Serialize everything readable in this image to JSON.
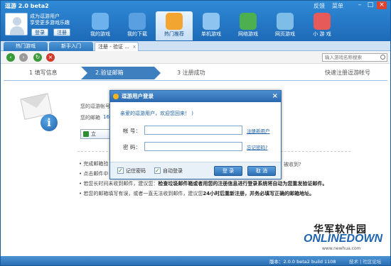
{
  "app": {
    "title": "逗游 2.0 beta2"
  },
  "titlebar": {
    "feedback": "反馈",
    "menu": "菜单"
  },
  "user": {
    "line1": "成为逗游用户",
    "line2": "享受更多游戏乐趣",
    "login_label": "登录",
    "register_label": "注册"
  },
  "nav": {
    "items": [
      {
        "label": "我的游戏",
        "icon": "gamepad-icon",
        "color": "#6db2ec"
      },
      {
        "label": "我的下载",
        "icon": "download-icon",
        "color": "#5aa0e0"
      },
      {
        "label": "热门推荐",
        "icon": "hot-recommend-icon",
        "color": "#f3a531",
        "active": true
      },
      {
        "label": "单机游戏",
        "icon": "controller-icon",
        "color": "#8ec4f0"
      },
      {
        "label": "网络游戏",
        "icon": "online-game-icon",
        "color": "#4caf50"
      },
      {
        "label": "网页游戏",
        "icon": "web-game-icon",
        "color": "#7fbde9"
      },
      {
        "label": "小 游 戏",
        "icon": "joystick-icon",
        "color": "#e65a5a"
      }
    ]
  },
  "tabs": [
    {
      "label": "热门游戏"
    },
    {
      "label": "新手入门"
    },
    {
      "label": "注册 - 验证 ...",
      "close": "x",
      "active": true
    }
  ],
  "toolbar": {
    "search_placeholder": "输入游戏名称搜索"
  },
  "steps": {
    "step1": "1 填写信息",
    "step2": "2.验证邮箱",
    "step3": "3 注册成功",
    "right_label": "快速注册逗游帐号"
  },
  "content": {
    "line1": "您的逗游帐号",
    "line2": "您的邮箱",
    "line2_value": "16",
    "button_label": "立",
    "right_note": "被收到?",
    "bullets": [
      "完成邮箱验",
      "点击邮件中",
      {
        "plain": "若您长时间未收到邮件，建议您：",
        "bold": "检查垃圾邮件箱或者用您的注册信息进行登录系统将自动为您重发验证邮件。"
      },
      {
        "plain": "若您的邮箱填写有误，或者一直无法收到邮件，建议您",
        "bold": "24小时后重新注册，并务必填写正确的邮箱地址。"
      }
    ]
  },
  "dialog": {
    "title": "逗游用户登录",
    "close": "×",
    "welcome": "亲爱的逗游用户，欢迎您回来！ )",
    "account_label": "帐  号：",
    "password_label": "密  码：",
    "account_value": "",
    "password_value": "",
    "register_link": "注册新用户",
    "forgot_link": "忘记密码?",
    "remember_label": "记住密码",
    "autologin_label": "自动登录",
    "check_mark": "✓",
    "login_button": "登  录",
    "cancel_button": "取  消"
  },
  "statusbar": {
    "version": "版本：2.0.0 beta2 build 1108",
    "link": "技术 | 社区论坛"
  },
  "watermark": {
    "cn": "华军软件园",
    "en": "ONLINEDOWN",
    "url": "www.newhua.com"
  }
}
